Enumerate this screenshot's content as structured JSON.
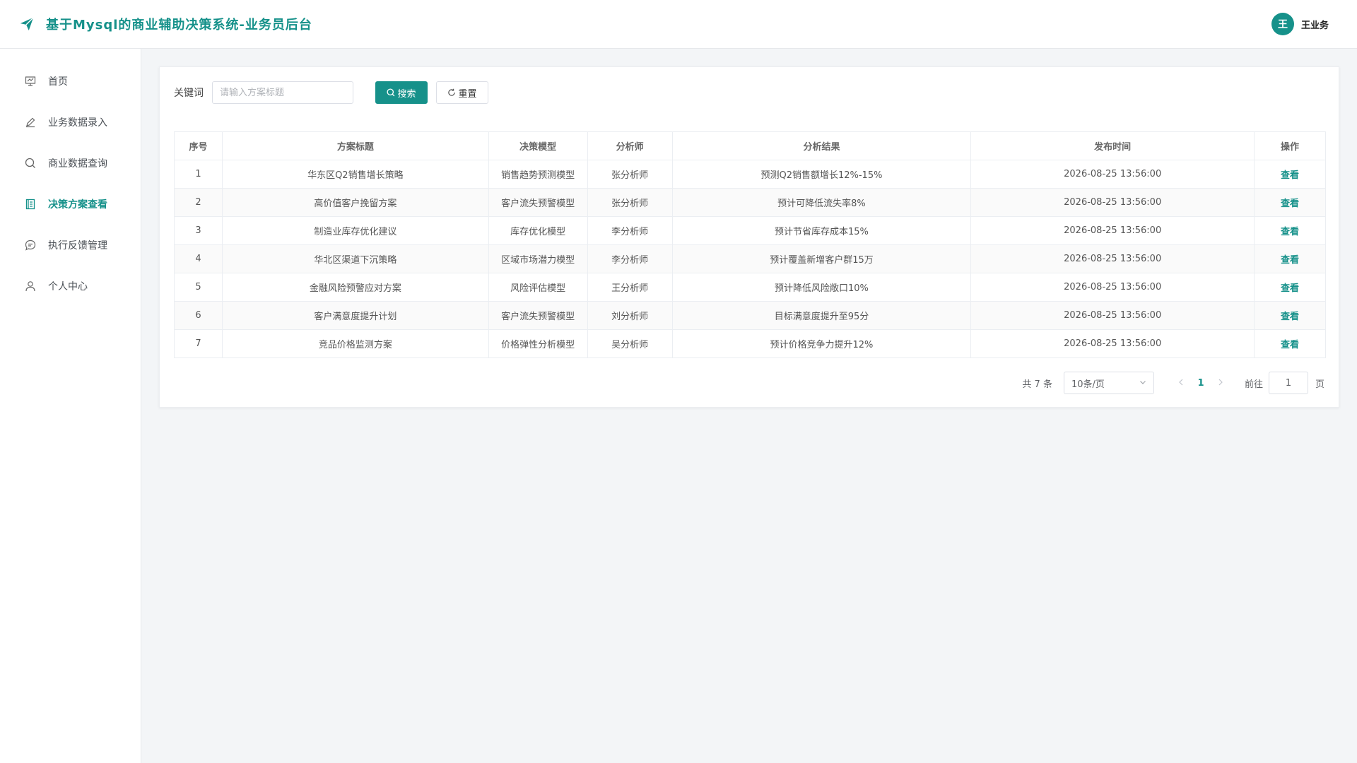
{
  "header": {
    "title": "基于Mysql的商业辅助决策系统-业务员后台",
    "avatar_text": "王",
    "username": "王业务",
    "brand_color": "#16918a"
  },
  "sidebar": {
    "items": [
      {
        "label": "首页",
        "icon": "presentation-icon",
        "active": false
      },
      {
        "label": "业务数据录入",
        "icon": "edit-pen-icon",
        "active": false
      },
      {
        "label": "商业数据查询",
        "icon": "search-icon",
        "active": false
      },
      {
        "label": "决策方案查看",
        "icon": "document-icon",
        "active": true
      },
      {
        "label": "执行反馈管理",
        "icon": "chat-bubble-icon",
        "active": false
      },
      {
        "label": "个人中心",
        "icon": "user-icon",
        "active": false
      }
    ]
  },
  "filter": {
    "label": "关键词",
    "placeholder": "请输入方案标题",
    "value": "",
    "search_label": "搜索",
    "reset_label": "重置"
  },
  "table": {
    "columns": [
      "序号",
      "方案标题",
      "决策模型",
      "分析师",
      "分析结果",
      "发布时间",
      "操作"
    ],
    "rows": [
      {
        "no": "1",
        "title": "华东区Q2销售增长策略",
        "model": "销售趋势预测模型",
        "analyst": "张分析师",
        "result": "预测Q2销售额增长12%-15%",
        "time": "2026-08-25 13:56:00",
        "action": "查看"
      },
      {
        "no": "2",
        "title": "高价值客户挽留方案",
        "model": "客户流失预警模型",
        "analyst": "张分析师",
        "result": "预计可降低流失率8%",
        "time": "2026-08-25 13:56:00",
        "action": "查看"
      },
      {
        "no": "3",
        "title": "制造业库存优化建议",
        "model": "库存优化模型",
        "analyst": "李分析师",
        "result": "预计节省库存成本15%",
        "time": "2026-08-25 13:56:00",
        "action": "查看"
      },
      {
        "no": "4",
        "title": "华北区渠道下沉策略",
        "model": "区域市场潜力模型",
        "analyst": "李分析师",
        "result": "预计覆盖新增客户群15万",
        "time": "2026-08-25 13:56:00",
        "action": "查看"
      },
      {
        "no": "5",
        "title": "金融风险预警应对方案",
        "model": "风险评估模型",
        "analyst": "王分析师",
        "result": "预计降低风险敞口10%",
        "time": "2026-08-25 13:56:00",
        "action": "查看"
      },
      {
        "no": "6",
        "title": "客户满意度提升计划",
        "model": "客户流失预警模型",
        "analyst": "刘分析师",
        "result": "目标满意度提升至95分",
        "time": "2026-08-25 13:56:00",
        "action": "查看"
      },
      {
        "no": "7",
        "title": "竞品价格监测方案",
        "model": "价格弹性分析模型",
        "analyst": "吴分析师",
        "result": "预计价格竞争力提升12%",
        "time": "2026-08-25 13:56:00",
        "action": "查看"
      }
    ]
  },
  "pagination": {
    "total_text": "共 7 条",
    "page_size": "10条/页",
    "current_page": "1",
    "goto_label": "前往",
    "goto_value": "1",
    "goto_suffix": "页"
  }
}
